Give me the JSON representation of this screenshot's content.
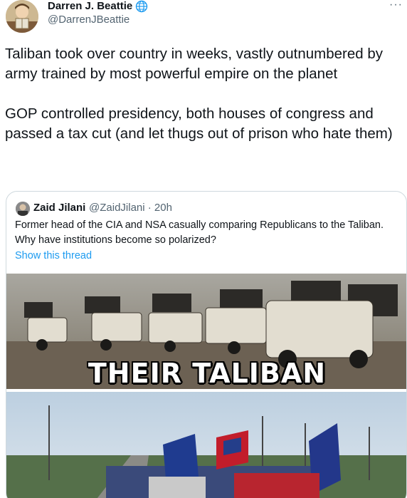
{
  "author": {
    "name": "Darren J. Beattie",
    "handle": "@DarrenJBeattie",
    "verified_icon": "globe-icon",
    "more_label": "···"
  },
  "tweet": {
    "paragraphs": [
      "Taliban took over country in weeks, vastly outnumbered by army trained by most powerful empire on the planet",
      "GOP controlled presidency, both houses of congress and passed a tax cut (and let thugs out of prison who hate them)"
    ]
  },
  "quoted_tweet": {
    "name": "Zaid Jilani",
    "meta": "@ZaidJilani · 20h",
    "text": "Former head of the CIA and NSA casually comparing Republicans to the Taliban. Why have institutions become so polarized?",
    "show_thread": "Show this thread"
  },
  "media": {
    "caption": "THEIR TALIBAN"
  },
  "colors": {
    "link": "#1d9bf0",
    "secondary": "#536471",
    "border": "#cfd9de"
  }
}
